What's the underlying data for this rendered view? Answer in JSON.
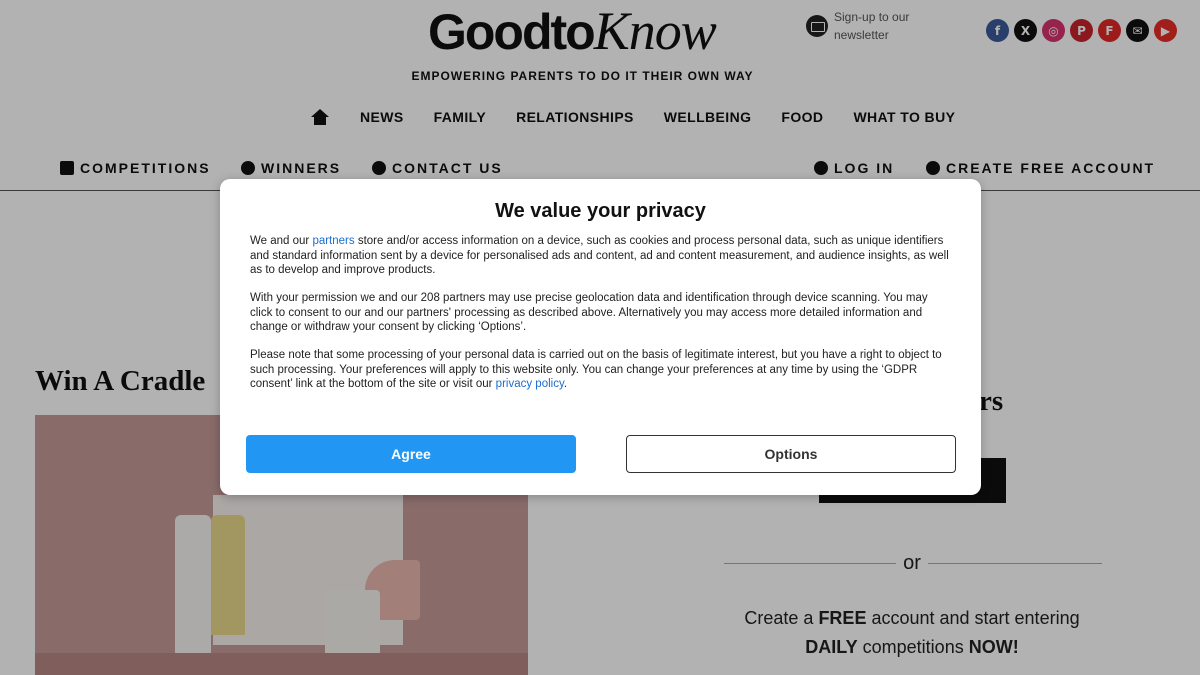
{
  "header": {
    "logo": {
      "part1": "Goodto",
      "part2": "Know"
    },
    "newsletter": {
      "line1": "Sign-up to our",
      "line2": "newsletter"
    },
    "socials": [
      {
        "name": "facebook",
        "glyph": "f",
        "color": "#3b5998"
      },
      {
        "name": "x",
        "glyph": "X",
        "color": "#111111"
      },
      {
        "name": "instagram",
        "glyph": "◎",
        "color": "#d6336c"
      },
      {
        "name": "pinterest",
        "glyph": "P",
        "color": "#c8232c"
      },
      {
        "name": "flipboard",
        "glyph": "F",
        "color": "#e12828"
      },
      {
        "name": "email",
        "glyph": "✉",
        "color": "#111111"
      },
      {
        "name": "youtube",
        "glyph": "▶",
        "color": "#e52d27"
      }
    ],
    "tagline": "EMPOWERING PARENTS TO DO IT THEIR OWN WAY"
  },
  "main_nav": [
    "NEWS",
    "FAMILY",
    "RELATIONSHIPS",
    "WELLBEING",
    "FOOD",
    "WHAT TO BUY"
  ],
  "sub_nav": {
    "competitions": "COMPETITIONS",
    "winners": "WINNERS",
    "contact": "CONTACT US",
    "login": "LOG IN",
    "create_account": "CREATE FREE ACCOUNT"
  },
  "content": {
    "competition_title": "Win A Cradle",
    "members_title": "bers",
    "or": "or",
    "promo": {
      "t1": "Create a ",
      "t2": "FREE",
      "t3": " account and start entering",
      "t4": "DAILY",
      "t5": " competitions ",
      "t6": "NOW!"
    }
  },
  "consent": {
    "title": "We value your privacy",
    "p1_before": "We and our ",
    "p1_link": "partners",
    "p1_after": " store and/or access information on a device, such as cookies and process personal data, such as unique identifiers and standard information sent by a device for personalised ads and content, ad and content measurement, and audience insights, as well as to develop and improve products.",
    "p2": "With your permission we and our 208 partners may use precise geolocation data and identification through device scanning. You may click to consent to our and our partners' processing as described above. Alternatively you may access more detailed information and change or withdraw your consent by clicking ‘Options’.",
    "p3_before": "Please note that some processing of your personal data is carried out on the basis of legitimate interest, but you have a right to object to such processing. Your preferences will apply to this website only. You can change your preferences at any time by using the ‘GDPR consent’ link at the bottom of the site or visit our ",
    "p3_link": "privacy policy",
    "p3_after": ".",
    "agree": "Agree",
    "options": "Options"
  }
}
